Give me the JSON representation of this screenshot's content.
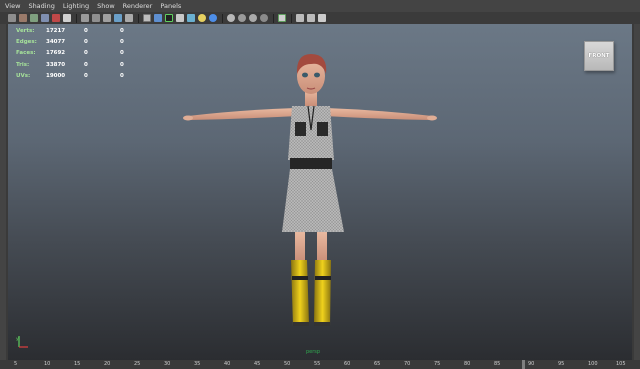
{
  "menubar": {
    "items": [
      "View",
      "Shading",
      "Lighting",
      "Show",
      "Renderer",
      "Panels"
    ]
  },
  "toolbar": {
    "icons": [
      "camera-select-icon",
      "camera-attribute-icon",
      "bookmark-icon",
      "image-plane-icon",
      "grid-icon",
      "film-gate-icon",
      "resolution-gate-icon",
      "gate-mask-icon",
      "field-chart-icon",
      "safe-action-icon",
      "safe-title-icon",
      "wireframe-icon",
      "smooth-shade-icon",
      "wireframe-on-shaded-icon",
      "textured-icon",
      "use-all-lights-icon",
      "shadows-icon",
      "high-quality-icon",
      "xray-icon",
      "xray-joints-icon",
      "isolate-select-icon",
      "hud-icon",
      "resolution-icon",
      "camera-frame-icon"
    ]
  },
  "hud": {
    "rows": [
      {
        "label": "Verts:",
        "v1": "17217",
        "v2": "0",
        "v3": "0"
      },
      {
        "label": "Edges:",
        "v1": "34077",
        "v2": "0",
        "v3": "0"
      },
      {
        "label": "Faces:",
        "v1": "17692",
        "v2": "0",
        "v3": "0"
      },
      {
        "label": "Tris:",
        "v1": "33870",
        "v2": "0",
        "v3": "0"
      },
      {
        "label": "UVs:",
        "v1": "19000",
        "v2": "0",
        "v3": "0"
      }
    ]
  },
  "viewcube": {
    "label": "FRONT"
  },
  "camera_label": "persp",
  "timeline": {
    "ticks": [
      "5",
      "10",
      "15",
      "20",
      "25",
      "30",
      "35",
      "40",
      "45",
      "50",
      "55",
      "60",
      "65",
      "70",
      "75",
      "80",
      "85",
      "",
      "90",
      "95",
      "100",
      "105"
    ]
  },
  "colors": {
    "hud_label": "#a6e29a",
    "viewport_top": "#6b7886",
    "viewport_bottom": "#2b2d31",
    "boots": "#e1c41a"
  }
}
